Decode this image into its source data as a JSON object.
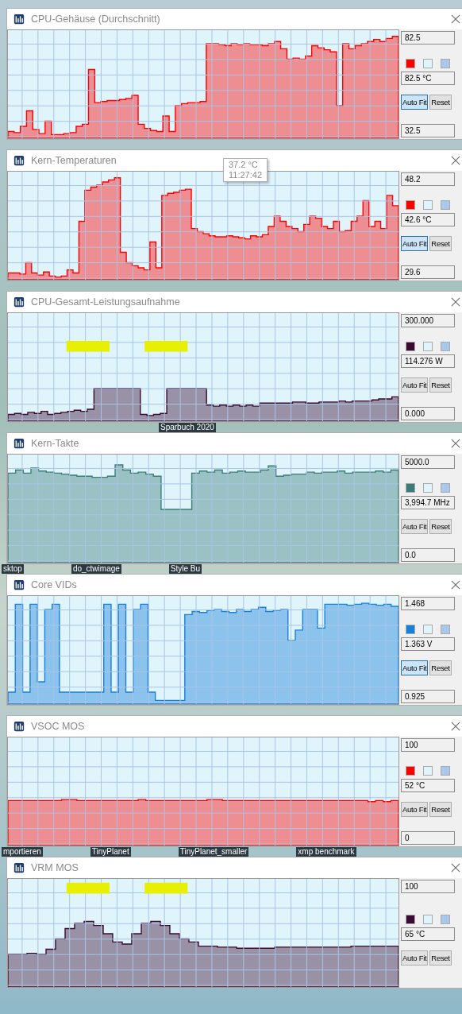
{
  "windows": [
    {
      "title": "CPU-Gehäuse (Durchschnitt)",
      "max": "82.5",
      "current": "82.5 °C",
      "min": "32.5",
      "color": "#ff0000",
      "highlighted": false,
      "buttons": [
        {
          "label": "Auto Fit",
          "pressed": true
        },
        {
          "label": "Reset",
          "pressed": false
        }
      ]
    },
    {
      "title": "Kern-Temperaturen",
      "max": "48.2",
      "current": "42.6 °C",
      "min": "29.6",
      "color": "#ff0000",
      "highlighted": false,
      "tooltip": {
        "value": "37.2 °C",
        "time": "11:27:42"
      },
      "buttons": [
        {
          "label": "Auto Fit",
          "pressed": true
        },
        {
          "label": "Reset",
          "pressed": false
        }
      ]
    },
    {
      "title": "CPU-Gesamt-Leistungsaufnahme",
      "max": "300.000",
      "current": "114.276 W",
      "min": "0.000",
      "color": "#3a0a30",
      "highlighted": true,
      "buttons": [
        {
          "label": "Auto Fit",
          "pressed": false
        },
        {
          "label": "Reset",
          "pressed": false
        }
      ],
      "desktop_labels_below": [
        "Sparbuch 2020"
      ]
    },
    {
      "title": "Kern-Takte",
      "max": "5000.0",
      "current": "3,994.7 MHz",
      "min": "0.0",
      "color": "#3c7c78",
      "highlighted": false,
      "buttons": [
        {
          "label": "Auto Fit",
          "pressed": false
        },
        {
          "label": "Reset",
          "pressed": false
        }
      ],
      "desktop_labels_below": [
        "sktop",
        "do_ctwimage",
        "Style Bu"
      ]
    },
    {
      "title": "Core VIDs",
      "max": "1.468",
      "current": "1.363 V",
      "min": "0.925",
      "color": "#1a7fd8",
      "highlighted": false,
      "buttons": [
        {
          "label": "Auto Fit",
          "pressed": true
        },
        {
          "label": "Reset",
          "pressed": false
        }
      ]
    },
    {
      "title": "VSOC MOS",
      "max": "100",
      "current": "52 °C",
      "min": "0",
      "color": "#ff0000",
      "highlighted": false,
      "buttons": [
        {
          "label": "Auto Fit",
          "pressed": false
        },
        {
          "label": "Reset",
          "pressed": false
        }
      ],
      "desktop_labels_below": [
        "mportieren",
        "TinyPlanet",
        "TinyPlanet_smaller",
        "xmp benchmark"
      ]
    },
    {
      "title": "VRM MOS",
      "max": "100",
      "current": "65 °C",
      "color": "#3a0a30",
      "highlighted": true,
      "buttons": [
        {
          "label": "Auto Fit",
          "pressed": false
        },
        {
          "label": "Reset",
          "pressed": false
        }
      ]
    }
  ]
}
